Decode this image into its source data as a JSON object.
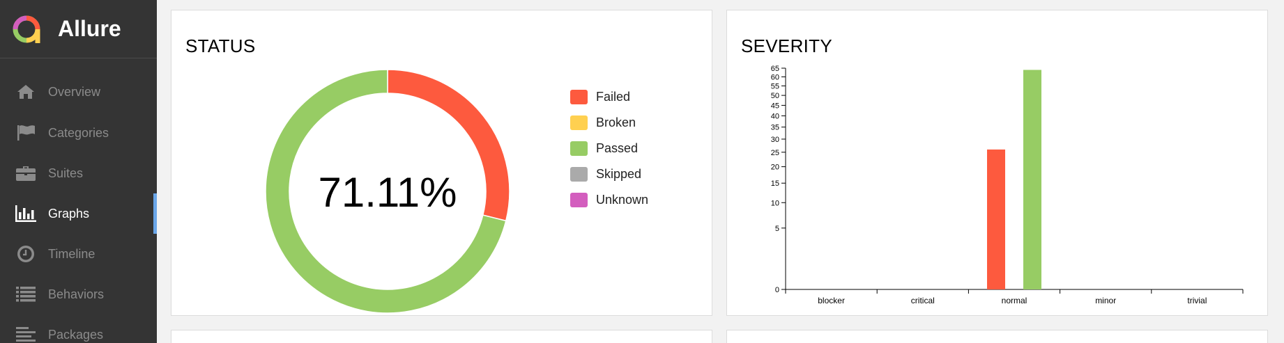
{
  "app": {
    "title": "Allure"
  },
  "sidebar": {
    "items": [
      {
        "label": "Overview",
        "icon": "home-icon",
        "active": false
      },
      {
        "label": "Categories",
        "icon": "flag-icon",
        "active": false
      },
      {
        "label": "Suites",
        "icon": "briefcase-icon",
        "active": false
      },
      {
        "label": "Graphs",
        "icon": "bar-chart-icon",
        "active": true
      },
      {
        "label": "Timeline",
        "icon": "clock-icon",
        "active": false
      },
      {
        "label": "Behaviors",
        "icon": "list-icon",
        "active": false
      },
      {
        "label": "Packages",
        "icon": "align-left-icon",
        "active": false
      }
    ]
  },
  "status": {
    "title": "STATUS",
    "percent_label": "71.11%",
    "legend": [
      {
        "label": "Failed",
        "color": "#fd5a3e"
      },
      {
        "label": "Broken",
        "color": "#ffd050"
      },
      {
        "label": "Passed",
        "color": "#97cc64"
      },
      {
        "label": "Skipped",
        "color": "#aaaaaa"
      },
      {
        "label": "Unknown",
        "color": "#d35ebe"
      }
    ]
  },
  "severity": {
    "title": "SEVERITY"
  },
  "chart_data": [
    {
      "type": "pie",
      "title": "STATUS",
      "center_label": "71.11%",
      "categories": [
        "Failed",
        "Broken",
        "Passed",
        "Skipped",
        "Unknown"
      ],
      "values": [
        26,
        0,
        64,
        0,
        0
      ],
      "colors": [
        "#fd5a3e",
        "#ffd050",
        "#97cc64",
        "#aaaaaa",
        "#d35ebe"
      ],
      "donut": true
    },
    {
      "type": "bar",
      "title": "SEVERITY",
      "categories": [
        "blocker",
        "critical",
        "normal",
        "minor",
        "trivial"
      ],
      "y_scale": "sqrt",
      "ylim": [
        0,
        65
      ],
      "yticks": [
        0,
        5,
        10,
        15,
        20,
        25,
        30,
        35,
        40,
        45,
        50,
        55,
        60,
        65
      ],
      "series": [
        {
          "values": [
            0,
            0,
            26,
            0,
            0
          ],
          "color": "#fd5a3e"
        },
        {
          "values": [
            0,
            0,
            64,
            0,
            0
          ],
          "color": "#97cc64"
        }
      ]
    }
  ]
}
